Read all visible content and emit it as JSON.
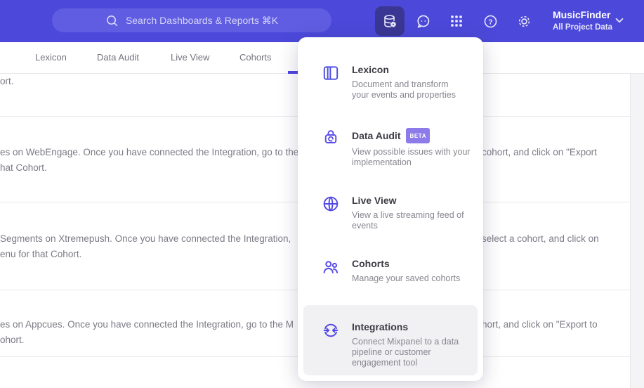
{
  "header": {
    "search": {
      "placeholder": "Search Dashboards & Reports ⌘K"
    },
    "project": {
      "name": "MusicFinder",
      "scope": "All Project Data"
    },
    "help_glyph": "?"
  },
  "tabs": {
    "items": [
      "Lexicon",
      "Data Audit",
      "Live View",
      "Cohorts"
    ]
  },
  "menu": {
    "items": [
      {
        "title": "Lexicon",
        "desc": "Document and transform\nyour events and properties"
      },
      {
        "title": "Data Audit",
        "badge": "BETA",
        "desc": "View possible issues with your\nimplementation"
      },
      {
        "title": "Live View",
        "desc": "View a live streaming feed of\nevents"
      },
      {
        "title": "Cohorts",
        "desc": "Manage your saved cohorts"
      },
      {
        "title": "Integrations",
        "desc": "Connect Mixpanel to a data\npipeline or customer\nengagement tool"
      }
    ]
  },
  "background": {
    "row1": {
      "line1": "ort."
    },
    "row2": {
      "left1": "es on WebEngage. Once you have connected the Integration, go to the",
      "right1": "cohort, and click on \"Export",
      "left2": "hat Cohort."
    },
    "row3": {
      "left1": "Segments on Xtremepush. Once you have connected the Integration,",
      "right1": "select a cohort, and click on",
      "left2": "enu for that Cohort."
    },
    "row4": {
      "left1": "es on Appcues. Once you have connected the Integration, go to the M",
      "right1": "hort, and click on \"Export to",
      "left2": "ohort."
    }
  },
  "colors": {
    "header_bg": "#4c49da",
    "search_bg": "#605de2",
    "active_button_bg": "#3a3794",
    "accent": "#4f44e0",
    "menu_icon": "#5348e6",
    "beta_badge_bg": "#8d7bea",
    "hover_highlight": "#f1f1f3"
  }
}
